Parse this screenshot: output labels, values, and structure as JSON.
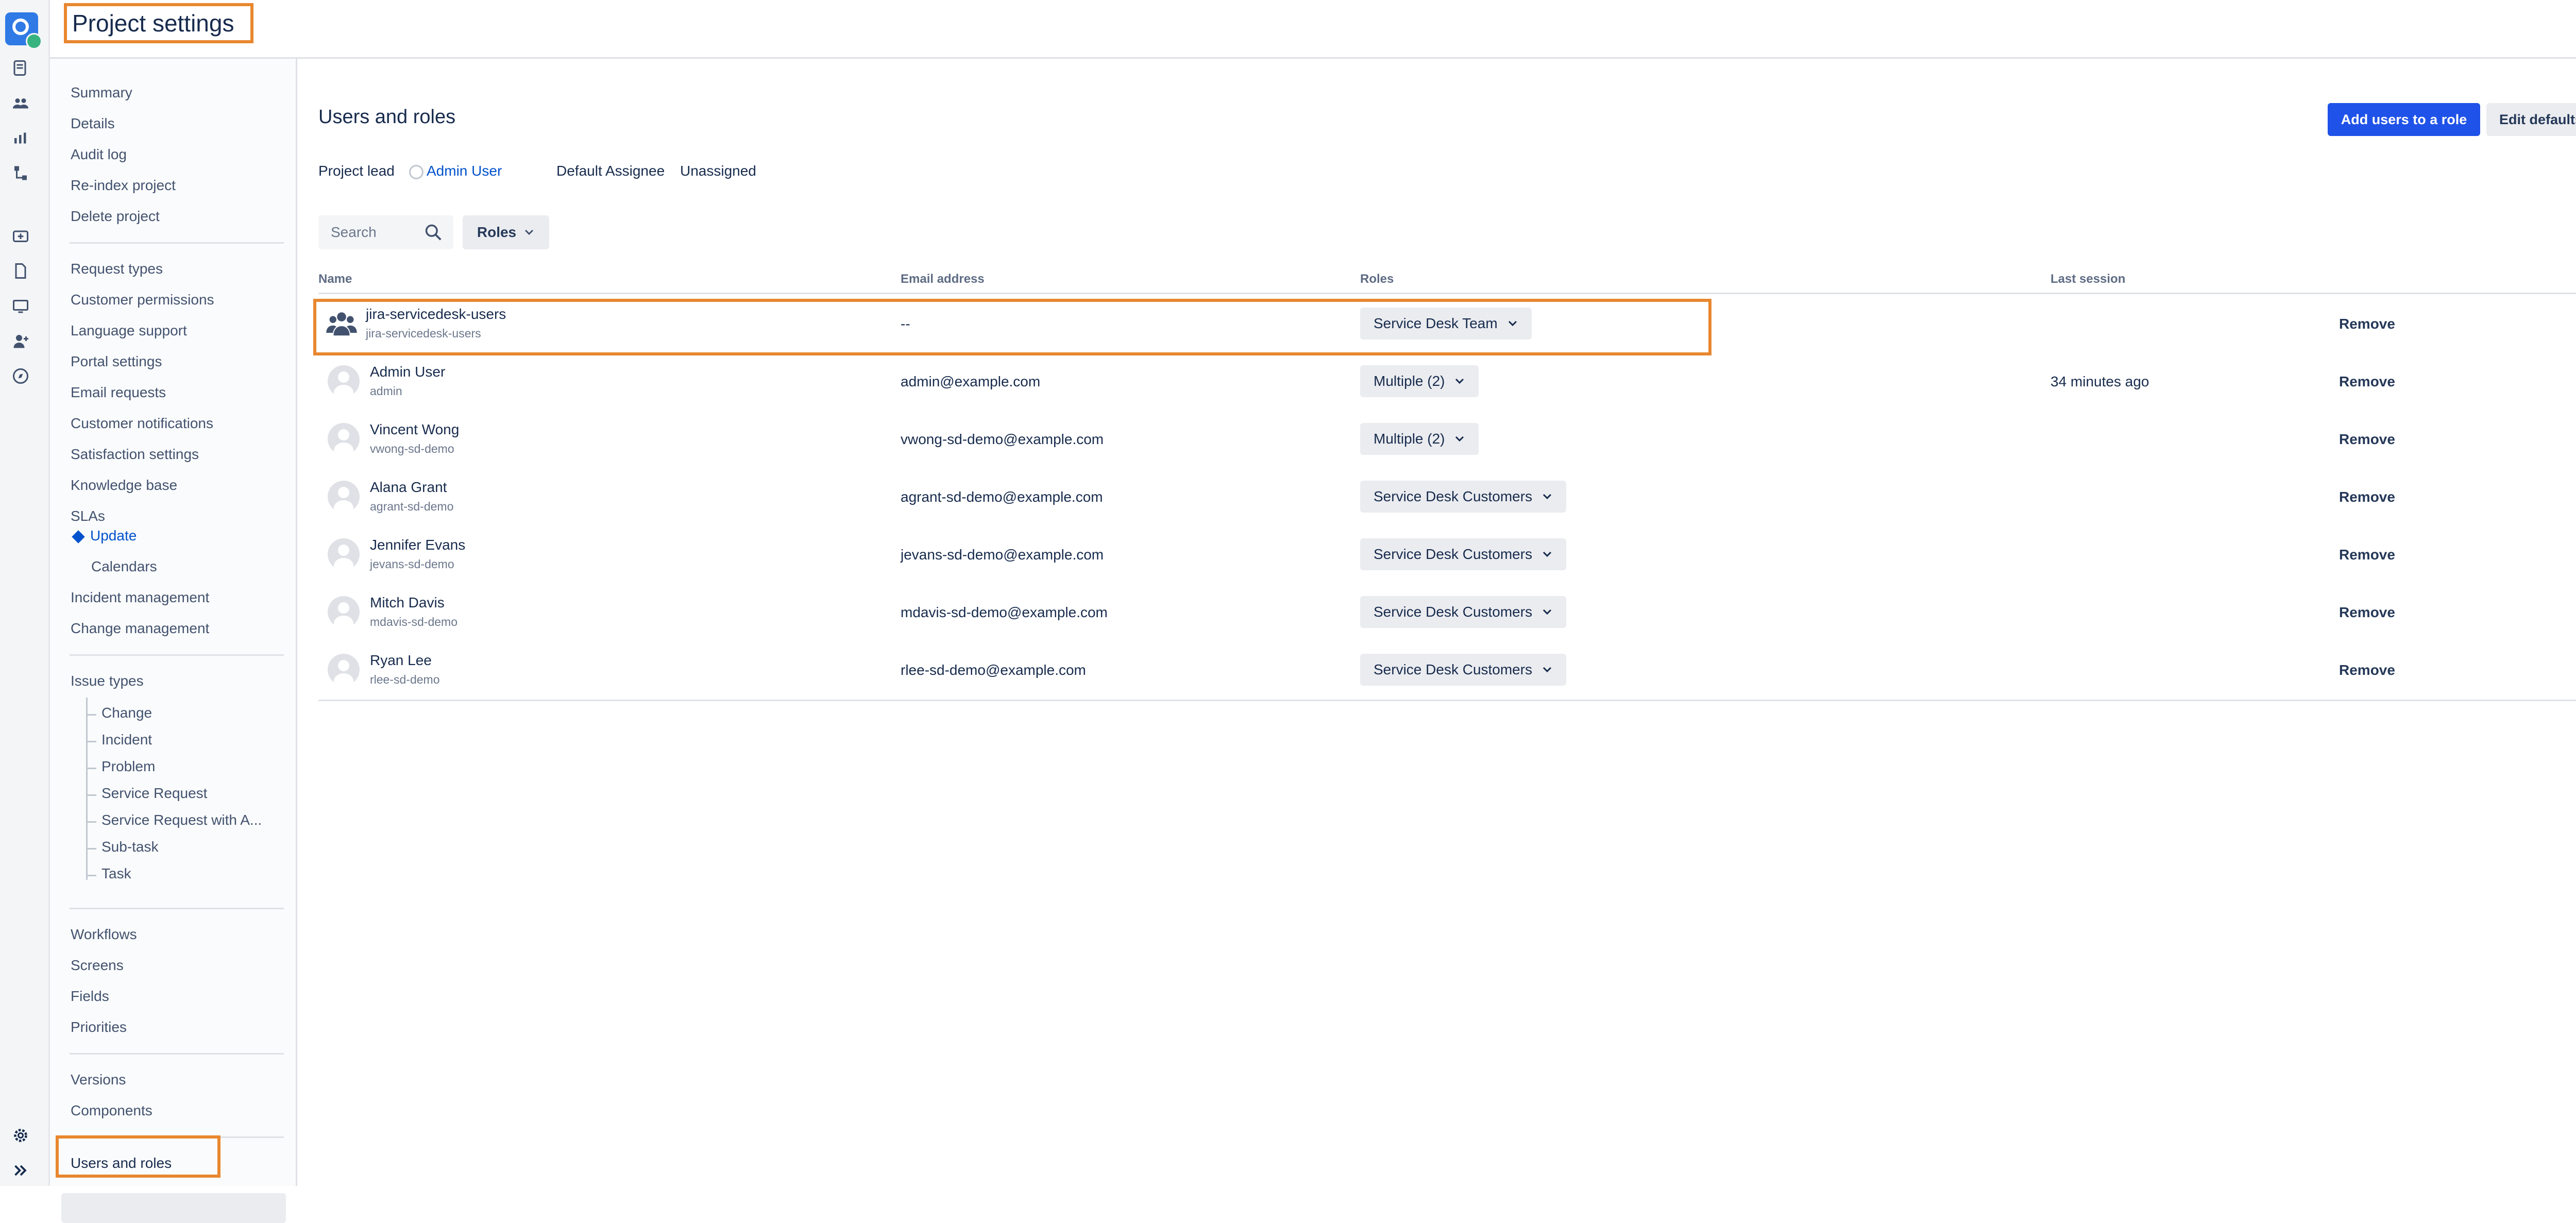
{
  "header": {
    "title": "Project settings"
  },
  "sidebar": {
    "group1": [
      "Summary",
      "Details",
      "Audit log",
      "Re-index project",
      "Delete project"
    ],
    "group2": [
      "Request types",
      "Customer permissions",
      "Language support",
      "Portal settings",
      "Email requests",
      "Customer notifications",
      "Satisfaction settings",
      "Knowledge base"
    ],
    "slas": {
      "label": "SLAs",
      "update": "Update",
      "calendars": "Calendars"
    },
    "group2b": [
      "Incident management",
      "Change management"
    ],
    "issue_types": {
      "label": "Issue types",
      "items": [
        "Change",
        "Incident",
        "Problem",
        "Service Request",
        "Service Request with A...",
        "Sub-task",
        "Task"
      ]
    },
    "group3": [
      "Workflows",
      "Screens",
      "Fields",
      "Priorities"
    ],
    "group4": [
      "Versions",
      "Components"
    ],
    "active": "Users and roles"
  },
  "main": {
    "title": "Users and roles",
    "add_button": "Add users to a role",
    "edit_defaults_button": "Edit defaults",
    "project_lead_label": "Project lead",
    "project_lead_value": "Admin User",
    "default_assignee_label": "Default Assignee",
    "default_assignee_value": "Unassigned",
    "search_placeholder": "Search",
    "roles_filter": "Roles",
    "columns": {
      "name": "Name",
      "email": "Email address",
      "roles": "Roles",
      "last_session": "Last session"
    },
    "rows": [
      {
        "name": "jira-servicedesk-users",
        "username": "jira-servicedesk-users",
        "email": "--",
        "role": "Service Desk Team",
        "last_session": "",
        "action": "Remove"
      },
      {
        "name": "Admin User",
        "username": "admin",
        "email": "admin@example.com",
        "role": "Multiple (2)",
        "last_session": "34 minutes ago",
        "action": "Remove"
      },
      {
        "name": "Vincent Wong",
        "username": "vwong-sd-demo",
        "email": "vwong-sd-demo@example.com",
        "role": "Multiple (2)",
        "last_session": "",
        "action": "Remove"
      },
      {
        "name": "Alana Grant",
        "username": "agrant-sd-demo",
        "email": "agrant-sd-demo@example.com",
        "role": "Service Desk Customers",
        "last_session": "",
        "action": "Remove"
      },
      {
        "name": "Jennifer Evans",
        "username": "jevans-sd-demo",
        "email": "jevans-sd-demo@example.com",
        "role": "Service Desk Customers",
        "last_session": "",
        "action": "Remove"
      },
      {
        "name": "Mitch Davis",
        "username": "mdavis-sd-demo",
        "email": "mdavis-sd-demo@example.com",
        "role": "Service Desk Customers",
        "last_session": "",
        "action": "Remove"
      },
      {
        "name": "Ryan Lee",
        "username": "rlee-sd-demo",
        "email": "rlee-sd-demo@example.com",
        "role": "Service Desk Customers",
        "last_session": "",
        "action": "Remove"
      }
    ]
  },
  "colors": {
    "accent": "#1f52e8",
    "highlight": "#e8872f",
    "link": "#0052cc"
  }
}
